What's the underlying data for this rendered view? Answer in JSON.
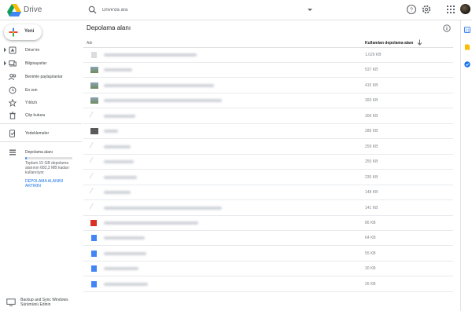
{
  "app": {
    "title": "Drive"
  },
  "search": {
    "placeholder": "Drive'da ara"
  },
  "sidebar": {
    "new_label": "Yeni",
    "items": [
      {
        "label": "Drive'ım",
        "icon": "my-drive-icon"
      },
      {
        "label": "Bilgisayarlar",
        "icon": "computers-icon"
      },
      {
        "label": "Benimle paylaşılanlar",
        "icon": "shared-icon"
      },
      {
        "label": "En son",
        "icon": "recent-icon"
      },
      {
        "label": "Yıldızlı",
        "icon": "star-icon"
      },
      {
        "label": "Çöp kutusu",
        "icon": "trash-icon"
      },
      {
        "label": "Yedeklemeler",
        "icon": "backups-icon"
      },
      {
        "label": "Depolama alanı",
        "icon": "storage-icon"
      }
    ],
    "storage_progress": 0.04,
    "storage_text": "Toplam 15 GB depolama alanının 682,2 MB kadarı kullanılıyor",
    "storage_link": "DEPOLAMA ALANINI ARTIRIN",
    "sync_text": "Backup and Sync Windows Sürümünü Edinin"
  },
  "main": {
    "title": "Depolama alanı",
    "col_name": "Adı",
    "col_size": "Kullanılan depolama alanı"
  },
  "files": [
    {
      "size": "1.029 KB",
      "thumb": "doc-gray"
    },
    {
      "size": "537 KB",
      "thumb": "image"
    },
    {
      "size": "415 KB",
      "thumb": "image"
    },
    {
      "size": "393 KB",
      "thumb": "image"
    },
    {
      "size": "306 KB",
      "thumb": "blank"
    },
    {
      "size": "285 KB",
      "thumb": "image-dark"
    },
    {
      "size": "259 KB",
      "thumb": "blank"
    },
    {
      "size": "255 KB",
      "thumb": "blank"
    },
    {
      "size": "235 KB",
      "thumb": "blank"
    },
    {
      "size": "148 KB",
      "thumb": "blank"
    },
    {
      "size": "141 KB",
      "thumb": "blank"
    },
    {
      "size": "86 KB",
      "thumb": "pdf"
    },
    {
      "size": "64 KB",
      "thumb": "doc"
    },
    {
      "size": "55 KB",
      "thumb": "doc"
    },
    {
      "size": "30 KB",
      "thumb": "doc"
    },
    {
      "size": "26 KB",
      "thumb": "doc"
    }
  ],
  "colors": {
    "accent": "#1a73e8",
    "storage_fill": "#4285f4",
    "keep_yellow": "#fbbc04"
  }
}
